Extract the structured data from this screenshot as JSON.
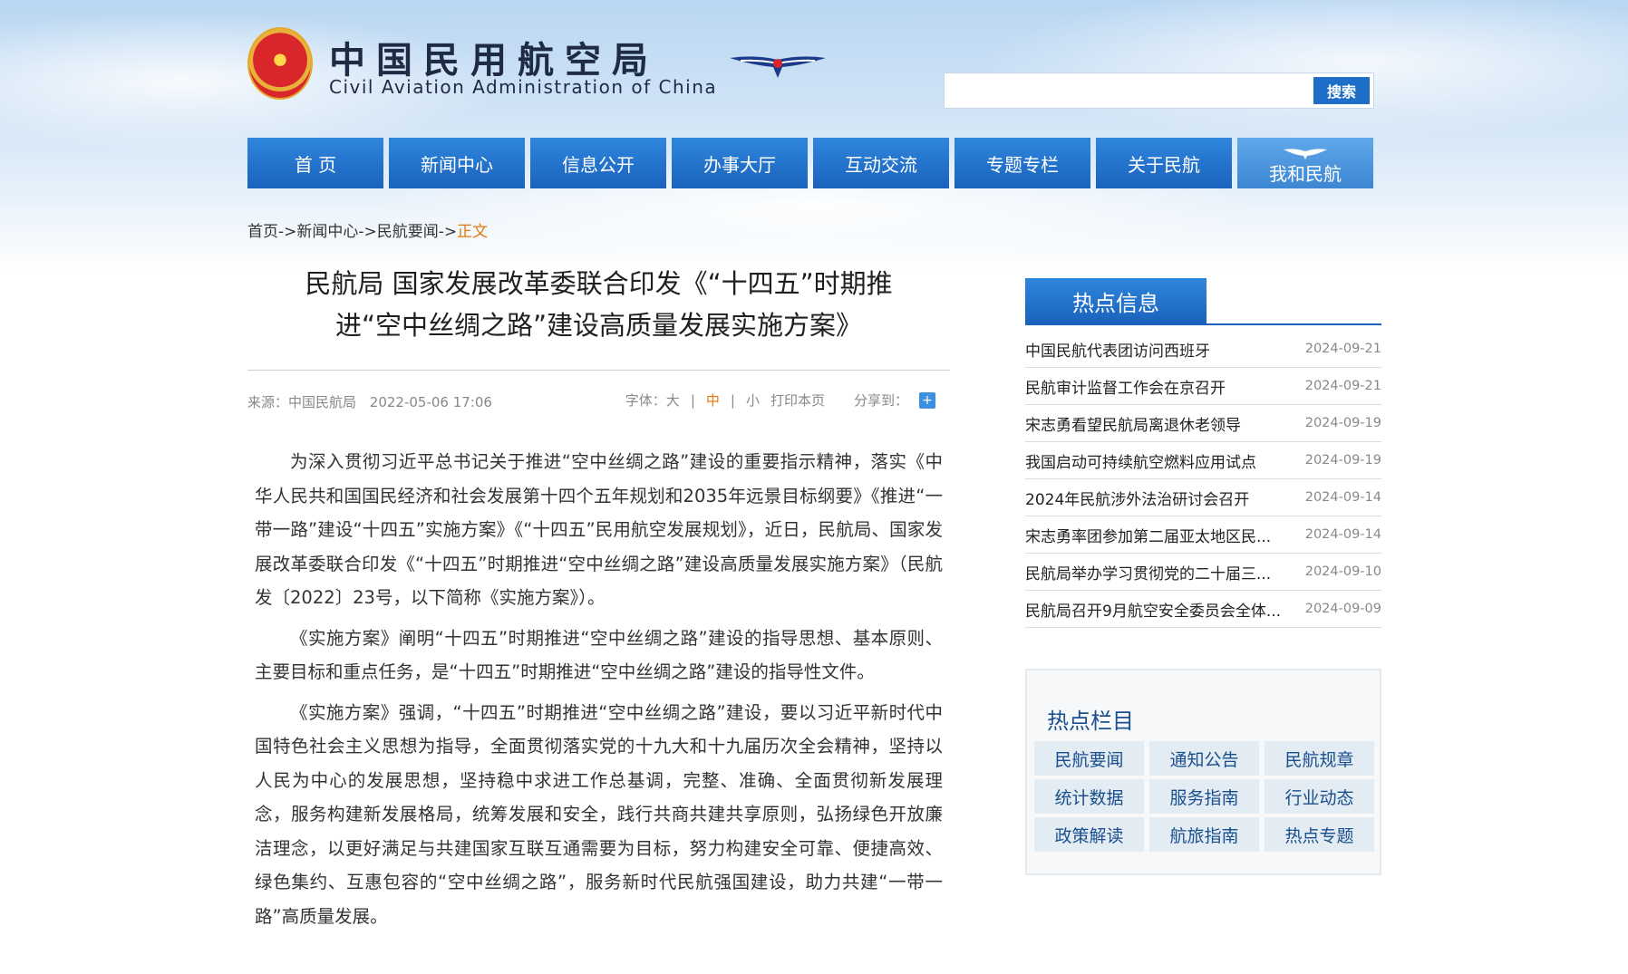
{
  "header": {
    "title_cn": "中国民用航空局",
    "title_en": "Civil Aviation Administration of China",
    "search_placeholder": "",
    "search_button": "搜索"
  },
  "nav": {
    "items": [
      {
        "label": "首 页"
      },
      {
        "label": "新闻中心"
      },
      {
        "label": "信息公开"
      },
      {
        "label": "办事大厅"
      },
      {
        "label": "互动交流"
      },
      {
        "label": "专题专栏"
      },
      {
        "label": "关于民航"
      },
      {
        "label": "我和民航"
      }
    ]
  },
  "breadcrumb": {
    "home": "首页",
    "news": "新闻中心",
    "section": "民航要闻",
    "sep": "->",
    "current": "正文"
  },
  "article": {
    "title": "民航局 国家发展改革委联合印发《“十四五”时期推进“空中丝绸之路”建设高质量发展实施方案》",
    "meta": {
      "source": "来源：中国民航局",
      "datetime": "2022-05-06 17:06",
      "font_label": "字体：",
      "font_large": "大",
      "font_mid": "中",
      "font_small": "小",
      "divider": "|",
      "print": "打印本页",
      "share": "分享到：",
      "share_icon": "+"
    },
    "paragraphs": [
      "为深入贯彻习近平总书记关于推进“空中丝绸之路”建设的重要指示精神，落实《中华人民共和国国民经济和社会发展第十四个五年规划和2035年远景目标纲要》《推进“一带一路”建设“十四五”实施方案》《“十四五”民用航空发展规划》，近日，民航局、国家发展改革委联合印发《“十四五”时期推进“空中丝绸之路”建设高质量发展实施方案》（民航发〔2022〕23号，以下简称《实施方案》）。",
      "《实施方案》阐明“十四五”时期推进“空中丝绸之路”建设的指导思想、基本原则、主要目标和重点任务，是“十四五”时期推进“空中丝绸之路”建设的指导性文件。",
      "《实施方案》强调，“十四五”时期推进“空中丝绸之路”建设，要以习近平新时代中国特色社会主义思想为指导，全面贯彻落实党的十九大和十九届历次全会精神，坚持以人民为中心的发展思想，坚持稳中求进工作总基调，完整、准确、全面贯彻新发展理念，服务构建新发展格局，统筹发展和安全，践行共商共建共享原则，弘扬绿色开放廉洁理念，以更好满足与共建国家互联互通需要为目标，努力构建安全可靠、便捷高效、绿色集约、互惠包容的“空中丝绸之路”，服务新时代民航强国建设，助力共建“一带一路”高质量发展。"
    ]
  },
  "hot_info": {
    "title": "热点信息",
    "items": [
      {
        "title": "中国民航代表团访问西班牙",
        "date": "2024-09-21"
      },
      {
        "title": "民航审计监督工作会在京召开",
        "date": "2024-09-21"
      },
      {
        "title": "宋志勇看望民航局离退休老领导",
        "date": "2024-09-19"
      },
      {
        "title": "我国启动可持续航空燃料应用试点",
        "date": "2024-09-19"
      },
      {
        "title": "2024年民航涉外法治研讨会召开",
        "date": "2024-09-14"
      },
      {
        "title": "宋志勇率团参加第二届亚太地区民...",
        "date": "2024-09-14"
      },
      {
        "title": "民航局举办学习贯彻党的二十届三...",
        "date": "2024-09-10"
      },
      {
        "title": "民航局召开9月航空安全委员会全体...",
        "date": "2024-09-09"
      }
    ]
  },
  "hot_columns": {
    "title": "热点栏目",
    "items": [
      "民航要闻",
      "通知公告",
      "民航规章",
      "统计数据",
      "服务指南",
      "行业动态",
      "政策解读",
      "航旅指南",
      "热点专题"
    ]
  }
}
